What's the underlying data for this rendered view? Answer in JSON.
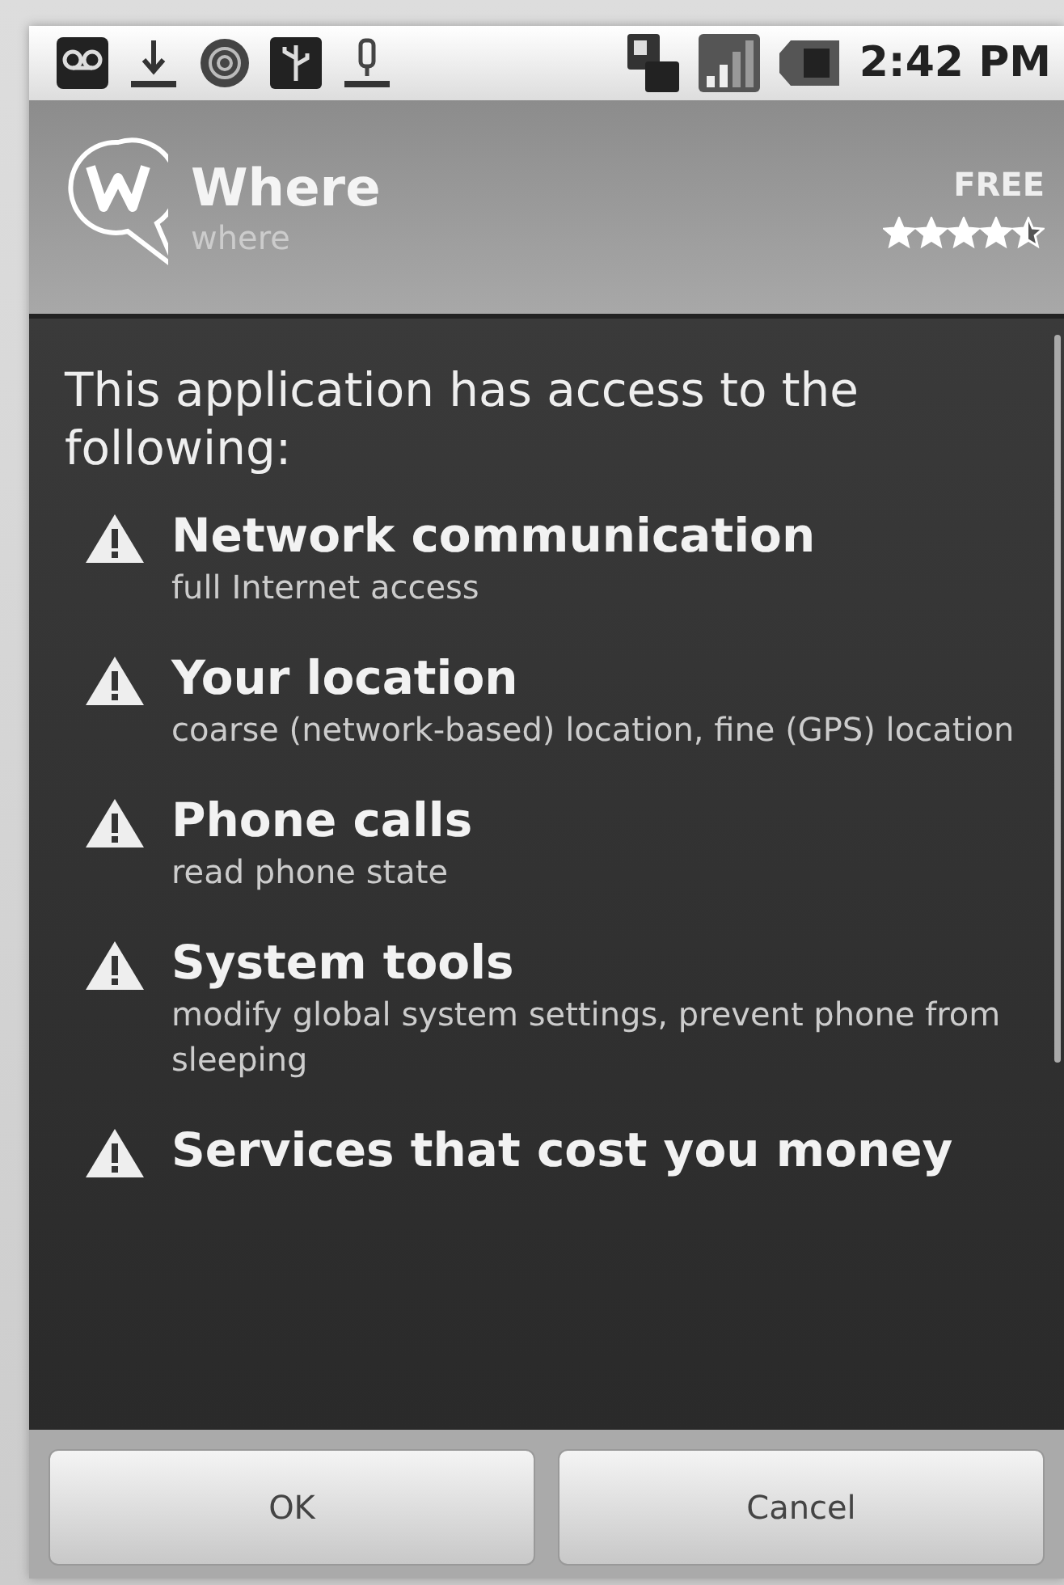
{
  "status_bar": {
    "time": "2:42 PM"
  },
  "app": {
    "name": "Where",
    "developer": "where",
    "price": "FREE",
    "stars": 4.5
  },
  "intro": "This application has access to the following:",
  "permissions": [
    {
      "title": "Network communication",
      "detail": "full Internet access"
    },
    {
      "title": "Your location",
      "detail": "coarse (network-based) location, fine (GPS) location"
    },
    {
      "title": "Phone calls",
      "detail": "read phone state"
    },
    {
      "title": "System tools",
      "detail": "modify global system settings, prevent phone from sleeping"
    },
    {
      "title": "Services that cost you money"
    }
  ],
  "buttons": [
    "OK",
    "Cancel"
  ]
}
